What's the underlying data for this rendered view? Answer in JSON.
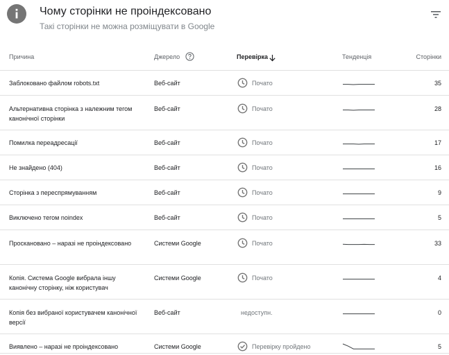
{
  "header": {
    "title": "Чому сторінки не проіндексовано",
    "subtitle": "Такі сторінки не можна розміщувати в Google"
  },
  "columns": {
    "reason": "Причина",
    "source": "Джерело",
    "validation": "Перевірка",
    "trend": "Тенденція",
    "pages": "Сторінки"
  },
  "rows": [
    {
      "reason": "Заблоковано файлом robots.txt",
      "source": "Веб-сайт",
      "status": "Почато",
      "status_icon": "clock-icon",
      "pages": "35",
      "trend": [
        0.3,
        0.3,
        0.25,
        0.3,
        0.3,
        0.3,
        0.3
      ]
    },
    {
      "reason": "Альтернативна сторінка з належним тегом канонічної сторінки",
      "source": "Веб-сайт",
      "status": "Почато",
      "status_icon": "clock-icon",
      "pages": "28",
      "trend": [
        0.3,
        0.3,
        0.25,
        0.3,
        0.3,
        0.3,
        0.3
      ]
    },
    {
      "reason": "Помилка переадресації",
      "source": "Веб-сайт",
      "status": "Почато",
      "status_icon": "clock-icon",
      "pages": "17",
      "trend": [
        0.3,
        0.3,
        0.3,
        0.25,
        0.3,
        0.3,
        0.3
      ]
    },
    {
      "reason": "Не знайдено (404)",
      "source": "Веб-сайт",
      "status": "Почато",
      "status_icon": "clock-icon",
      "pages": "16",
      "trend": [
        0.3,
        0.3,
        0.3,
        0.3,
        0.3,
        0.3,
        0.3
      ]
    },
    {
      "reason": "Сторінка з переспрямуванням",
      "source": "Веб-сайт",
      "status": "Почато",
      "status_icon": "clock-icon",
      "pages": "9",
      "trend": [
        0.3,
        0.3,
        0.3,
        0.3,
        0.3,
        0.3,
        0.3
      ]
    },
    {
      "reason": "Виключено тегом noindex",
      "source": "Веб-сайт",
      "status": "Почато",
      "status_icon": "clock-icon",
      "pages": "5",
      "trend": [
        0.3,
        0.3,
        0.3,
        0.3,
        0.3,
        0.3,
        0.3
      ]
    },
    {
      "reason": "Проскановано – наразі не проіндексовано",
      "source": "Системи Google",
      "status": "Почато",
      "status_icon": "clock-icon",
      "pages": "33",
      "trend": [
        0.35,
        0.3,
        0.3,
        0.3,
        0.32,
        0.3,
        0.3
      ]
    },
    {
      "reason": "Копія. Система Google вибрала іншу канонічну сторінку, ніж користувач",
      "source": "Системи Google",
      "status": "Почато",
      "status_icon": "clock-icon",
      "pages": "4",
      "trend": [
        0.3,
        0.3,
        0.3,
        0.3,
        0.3,
        0.3,
        0.3
      ]
    },
    {
      "reason": "Копія без вибраної користувачем канонічної версії",
      "source": "Веб-сайт",
      "status": "недоступн.",
      "status_icon": "",
      "pages": "0",
      "trend": [
        0.3,
        0.3,
        0.3,
        0.3,
        0.3,
        0.3,
        0.3
      ]
    },
    {
      "reason": "Виявлено – наразі не проіндексовано",
      "source": "Системи Google",
      "status": "Перевірку пройдено",
      "status_icon": "check-circle-icon",
      "pages": "5",
      "trend": [
        1.0,
        0.6,
        0.1,
        0.1,
        0.1,
        0.1,
        0.1
      ]
    }
  ],
  "colors": {
    "icon_gray": "#757575",
    "sparkline": "#3c4043",
    "divider": "#e0e0e0"
  }
}
